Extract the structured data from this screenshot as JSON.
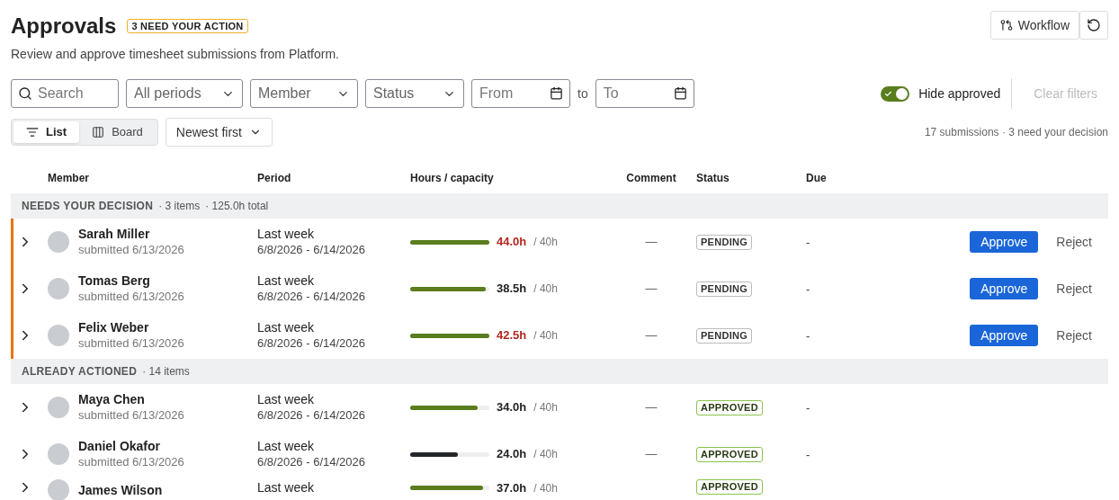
{
  "header": {
    "title": "Approvals",
    "badge": "3 NEED YOUR ACTION",
    "subtitle": "Review and approve timesheet submissions from Platform.",
    "workflow_button": "Workflow"
  },
  "filters": {
    "search": {
      "placeholder": "Search"
    },
    "selects": [
      "All periods",
      "Member",
      "Status"
    ],
    "from": {
      "placeholder": "From"
    },
    "to_label": "to",
    "to": {
      "placeholder": "To"
    },
    "hide_approved": {
      "label": "Hide approved",
      "on": true
    },
    "clear": {
      "label": "Clear filters",
      "disabled": true
    }
  },
  "views": [
    {
      "label": "List",
      "selected": true,
      "kind": "list"
    },
    {
      "label": "Board",
      "selected": false,
      "kind": "board"
    }
  ],
  "sort": "Newest first",
  "summary": "17 submissions · 3 need your decision",
  "table": {
    "columns": [
      "Member",
      "Period",
      "Hours / capacity",
      "Comment",
      "Status",
      "Due"
    ],
    "groups": [
      {
        "title": "NEEDS YOUR DECISION",
        "meta": [
          "· 3 items",
          "· 125.0h total"
        ],
        "highlight": true,
        "rows": [
          {
            "name": "Sarah Miller",
            "submitted": "submitted 6/13/2026",
            "period": "Last week",
            "range": "6/8/2026 - 6/14/2026",
            "level": 1,
            "color": "#5a7d1e",
            "hours": "44.0h",
            "over": true,
            "capacity": "/ 40h",
            "comment": "—",
            "status": "PENDING",
            "due": "-",
            "approve": "Approve",
            "reject": "Reject"
          },
          {
            "name": "Tomas Berg",
            "submitted": "submitted 6/13/2026",
            "period": "Last week",
            "range": "6/8/2026 - 6/14/2026",
            "level": 0.96,
            "color": "#5a7d1e",
            "hours": "38.5h",
            "over": false,
            "capacity": "/ 40h",
            "comment": "—",
            "status": "PENDING",
            "due": "-",
            "approve": "Approve",
            "reject": "Reject"
          },
          {
            "name": "Felix Weber",
            "submitted": "submitted 6/13/2026",
            "period": "Last week",
            "range": "6/8/2026 - 6/14/2026",
            "level": 1,
            "color": "#5a7d1e",
            "hours": "42.5h",
            "over": true,
            "capacity": "/ 40h",
            "comment": "—",
            "status": "PENDING",
            "due": "-",
            "approve": "Approve",
            "reject": "Reject"
          }
        ]
      },
      {
        "title": "ALREADY ACTIONED",
        "meta": [
          "· 14 items"
        ],
        "highlight": false,
        "rows": [
          {
            "name": "Maya Chen",
            "submitted": "submitted 6/13/2026",
            "period": "Last week",
            "range": "6/8/2026 - 6/14/2026",
            "level": 0.85,
            "color": "#5a7d1e",
            "hours": "34.0h",
            "over": false,
            "capacity": "/ 40h",
            "comment": "—",
            "status": "APPROVED",
            "due": "-"
          },
          {
            "name": "Daniel Okafor",
            "submitted": "submitted 6/13/2026",
            "period": "Last week",
            "range": "6/8/2026 - 6/14/2026",
            "level": 0.6,
            "color": "#24272b",
            "hours": "24.0h",
            "over": false,
            "capacity": "/ 40h",
            "comment": "—",
            "status": "APPROVED",
            "due": "-"
          },
          {
            "name": "James Wilson",
            "period": "Last week",
            "level": 0.92,
            "color": "#5a7d1e",
            "hours": "37.0h",
            "over": false,
            "capacity": "/ 40h",
            "status": "APPROVED"
          }
        ]
      }
    ]
  }
}
